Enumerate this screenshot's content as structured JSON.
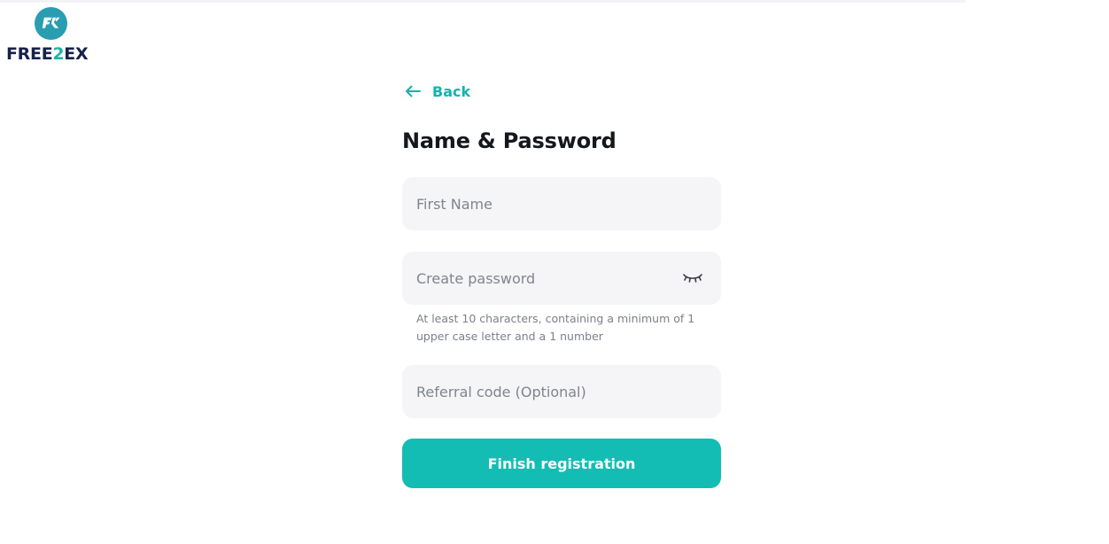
{
  "brand": {
    "logo_prefix": "FREE",
    "logo_digit": "2",
    "logo_suffix": "EX",
    "mark_color": "#2a9db0",
    "word_color": "#17214a",
    "accent": "#19b7aa"
  },
  "nav": {
    "back_label": "Back",
    "back_icon": "arrow-left-icon"
  },
  "form": {
    "title": "Name & Password",
    "first_name": {
      "placeholder": "First Name",
      "value": ""
    },
    "password": {
      "placeholder": "Create password",
      "value": "",
      "toggle_icon": "eye-closed-icon"
    },
    "password_hint": "At least 10 characters, containing a minimum of 1 upper case letter and a 1 number",
    "referral": {
      "placeholder": "Referral code (Optional)",
      "value": ""
    },
    "submit_label": "Finish registration"
  },
  "colors": {
    "primary": "#13bdb3",
    "field_bg": "#f5f5f7",
    "placeholder": "#80848c",
    "hint": "#7c8088"
  }
}
